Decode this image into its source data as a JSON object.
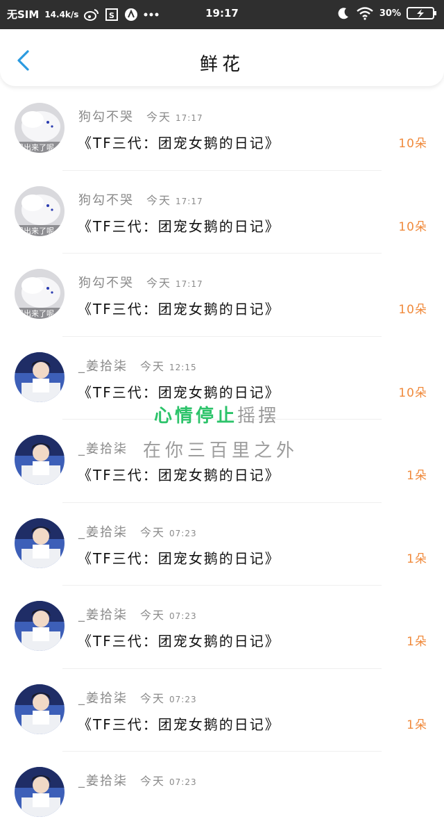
{
  "status_bar": {
    "carrier": "无SIM",
    "speed": "14.4k/s",
    "time": "19:17",
    "battery": "30%",
    "icons": [
      "weibo-icon",
      "screenshot-icon",
      "app-icon",
      "more-dots-icon",
      "moon-icon",
      "wifi-icon",
      "battery-icon"
    ]
  },
  "header": {
    "title": "鲜花",
    "back_icon": "chevron-left-icon"
  },
  "colors": {
    "accent_blue": "#2b9be0",
    "flower_orange": "#f08a3c",
    "overlay_green": "#2cc36a"
  },
  "rows": [
    {
      "name": "狗勾不哭",
      "time_label": "今天",
      "time": "17:17",
      "title": "《TF三代：团宠女鹅的日记》",
      "flowers": "10朵",
      "avatar": "white-fluffy-avatar"
    },
    {
      "name": "狗勾不哭",
      "time_label": "今天",
      "time": "17:17",
      "title": "《TF三代：团宠女鹅的日记》",
      "flowers": "10朵",
      "avatar": "white-fluffy-avatar"
    },
    {
      "name": "狗勾不哭",
      "time_label": "今天",
      "time": "17:17",
      "title": "《TF三代：团宠女鹅的日记》",
      "flowers": "10朵",
      "avatar": "white-fluffy-avatar"
    },
    {
      "name": "_姜拾柒",
      "time_label": "今天",
      "time": "12:15",
      "title": "《TF三代：团宠女鹅的日记》",
      "flowers": "10朵",
      "avatar": "person-avatar"
    },
    {
      "name": "_姜拾柒",
      "time_label": "",
      "time": "",
      "title": "《TF三代：团宠女鹅的日记》",
      "flowers": "1朵",
      "avatar": "person-avatar"
    },
    {
      "name": "_姜拾柒",
      "time_label": "今天",
      "time": "07:23",
      "title": "《TF三代：团宠女鹅的日记》",
      "flowers": "1朵",
      "avatar": "person-avatar"
    },
    {
      "name": "_姜拾柒",
      "time_label": "今天",
      "time": "07:23",
      "title": "《TF三代：团宠女鹅的日记》",
      "flowers": "1朵",
      "avatar": "person-avatar"
    },
    {
      "name": "_姜拾柒",
      "time_label": "今天",
      "time": "07:23",
      "title": "《TF三代：团宠女鹅的日记》",
      "flowers": "1朵",
      "avatar": "person-avatar"
    },
    {
      "name": "_姜拾柒",
      "time_label": "今天",
      "time": "07:23",
      "title": "",
      "flowers": "",
      "avatar": "person-avatar"
    }
  ],
  "overlay": {
    "line1_bold": "心情停止",
    "line1_fade": "摇摆",
    "line2": "在你三百里之外"
  }
}
